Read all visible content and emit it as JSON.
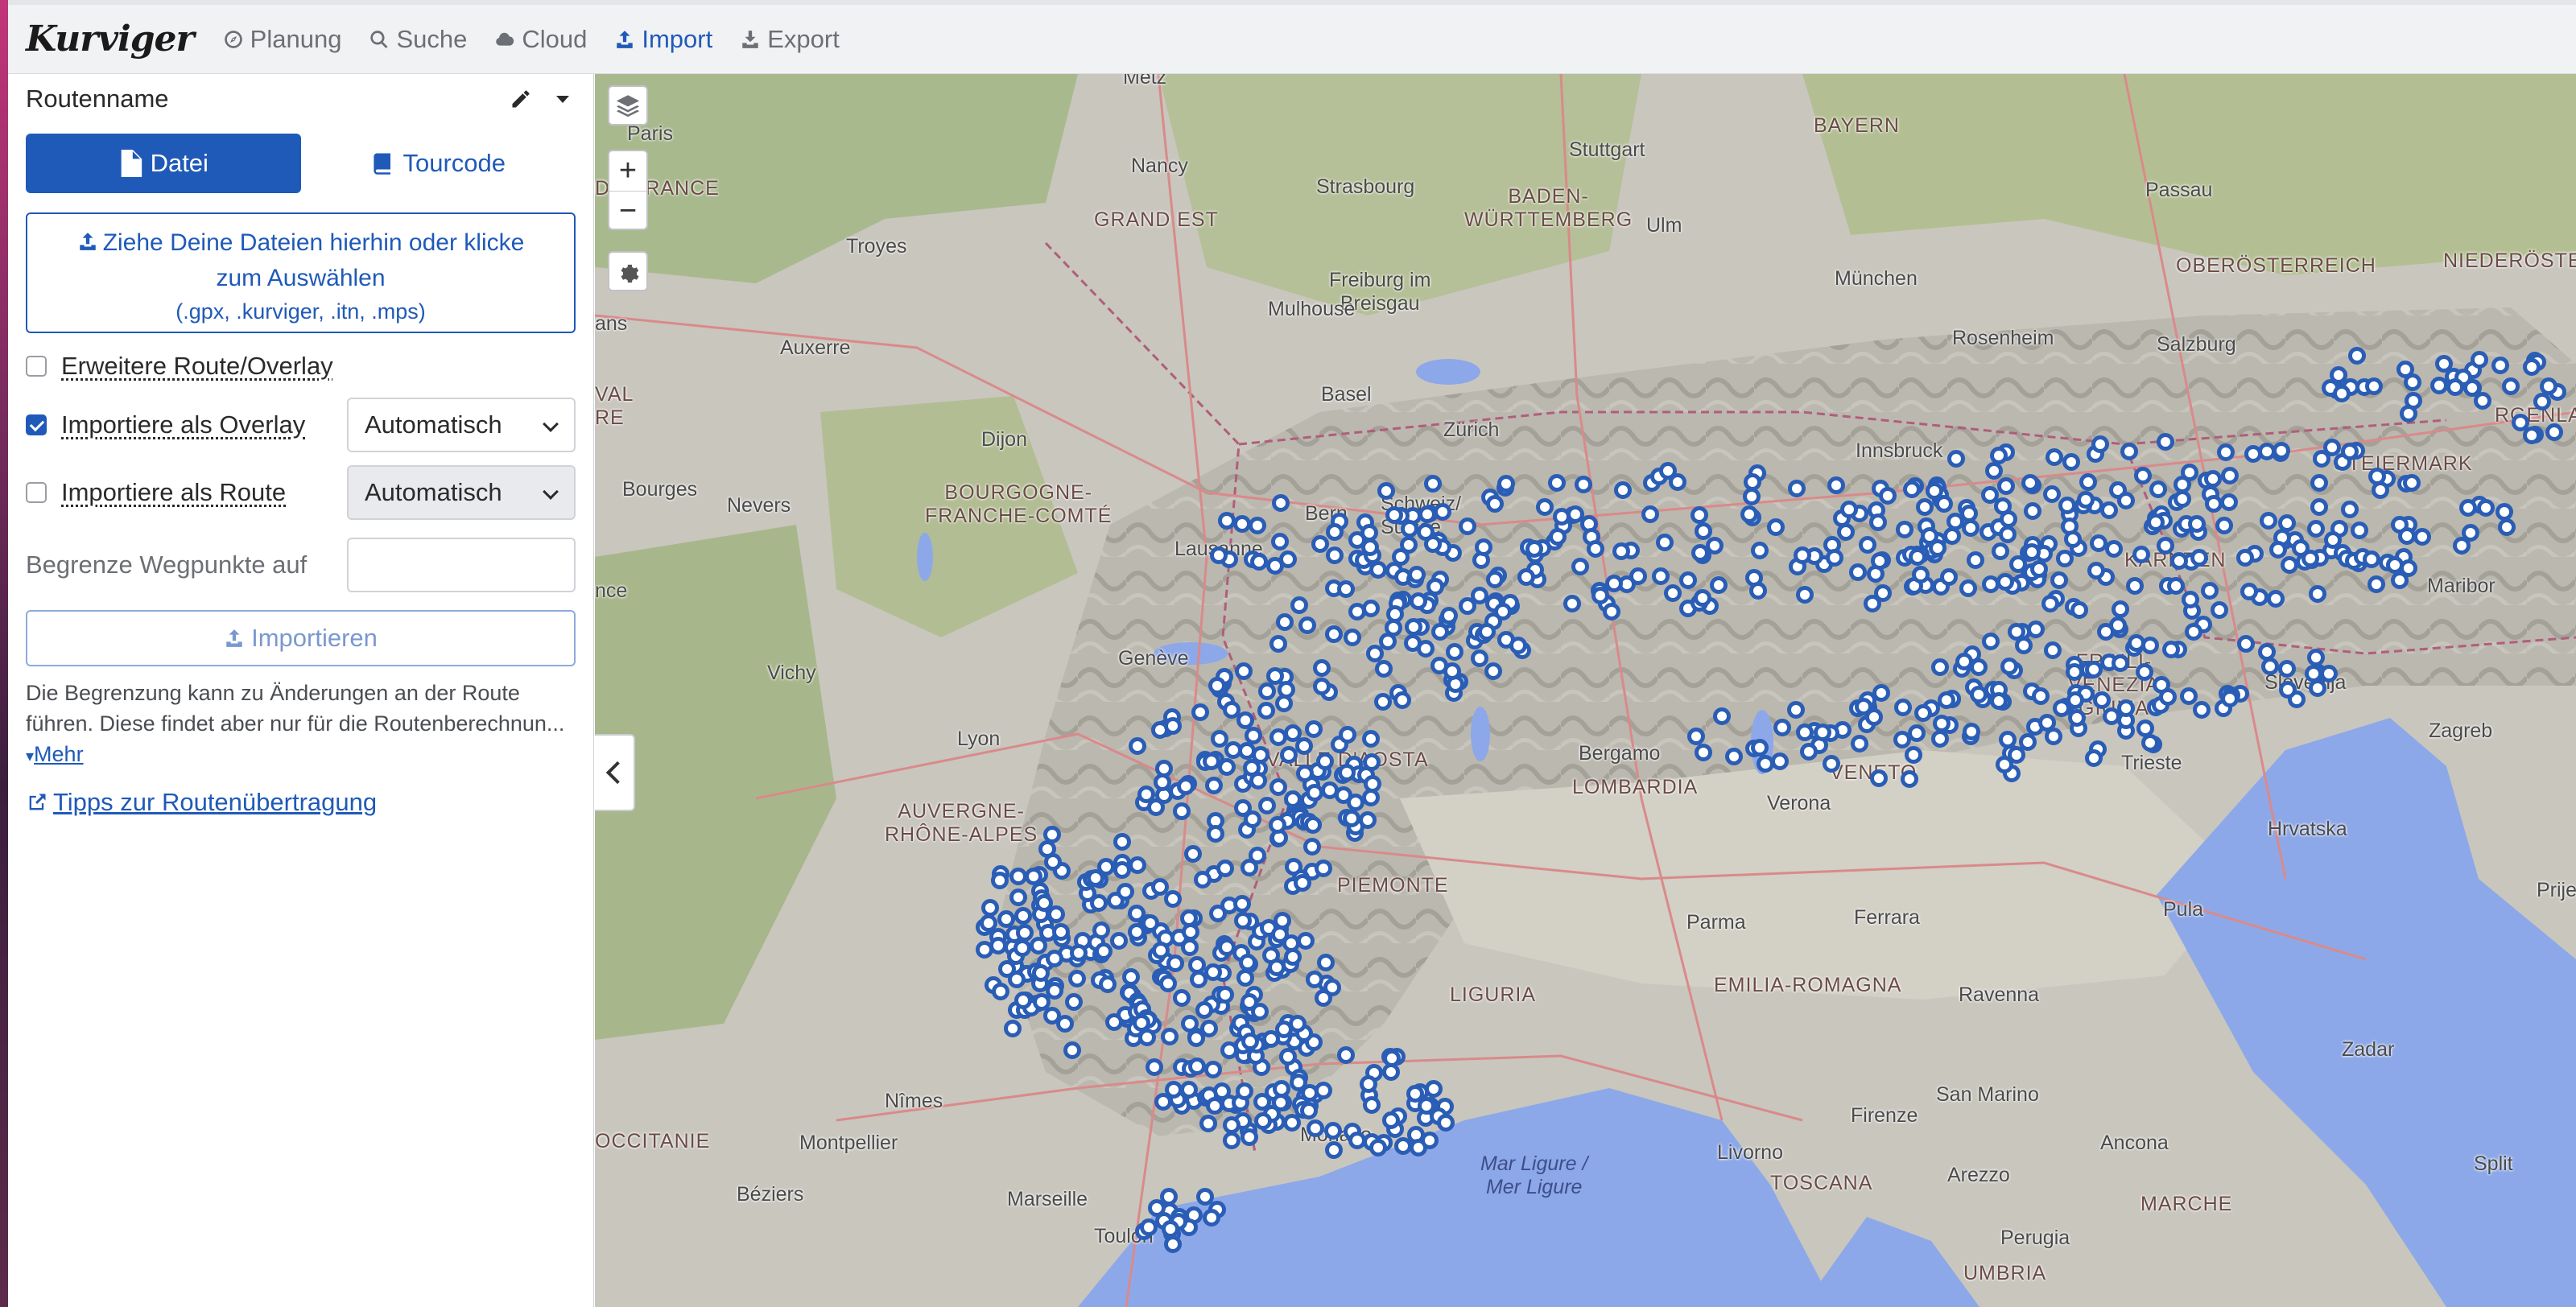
{
  "app": {
    "brand": "Kurviger"
  },
  "nav": {
    "items": [
      {
        "label": "Planung",
        "icon": "compass-icon"
      },
      {
        "label": "Suche",
        "icon": "search-icon"
      },
      {
        "label": "Cloud",
        "icon": "cloud-icon"
      },
      {
        "label": "Import",
        "icon": "upload-icon",
        "active": true
      },
      {
        "label": "Export",
        "icon": "download-icon"
      }
    ]
  },
  "sidebar": {
    "route_name": "Routenname",
    "tabs": {
      "file": "Datei",
      "tourcode": "Tourcode"
    },
    "dropzone": {
      "main": "Ziehe Deine Dateien hierhin oder klicke zum Auswählen",
      "formats": "(.gpx, .kurviger, .itn, .mps)"
    },
    "options": {
      "extended": {
        "label": "Erweitere Route/Overlay",
        "checked": false
      },
      "overlay": {
        "label": "Importiere als Overlay",
        "checked": true,
        "select": "Automatisch"
      },
      "route": {
        "label": "Importiere als Route",
        "checked": false,
        "select": "Automatisch"
      }
    },
    "limit": {
      "label": "Begrenze Wegpunkte auf",
      "value": ""
    },
    "import_button": "Importieren",
    "hint": "Die Begrenzung kann zu Änderungen an der Route führen. Diese findet aber nur für die Routenberechnun...",
    "more": "Mehr",
    "tips_link": "Tipps zur Routenübertragung"
  },
  "map": {
    "controls": {
      "zoom_in": "+",
      "zoom_out": "−"
    },
    "labels": {
      "metz": "Metz",
      "paris": "Paris",
      "de_france": "DE-FRANCE",
      "nancy": "Nancy",
      "grand_est": "GRAND EST",
      "strasbourg": "Strasbourg",
      "stuttgart": "Stuttgart",
      "baden": "BADEN-\nWÜRTTEMBERG",
      "ulm": "Ulm",
      "bayern": "BAYERN",
      "passau": "Passau",
      "troyes": "Troyes",
      "freiburg": "Freiburg im\nBreisgau",
      "munchen": "München",
      "oberosterreich": "OBERÖSTERREICH",
      "niederosterreich": "NIEDERÖSTERREICH",
      "auxerre": "Auxerre",
      "mulhouse": "Mulhouse",
      "rosenheim": "Rosenheim",
      "salzburg": "Salzburg",
      "ans": "ans",
      "basel": "Basel",
      "zurich": "Zürich",
      "val_re": "VAL\nRE",
      "dijon": "Dijon",
      "innsbruck": "Innsbruck",
      "bourgogne": "BOURGOGNE-\nFRANCHE-COMTÉ",
      "bourges": "Bourges",
      "nevers": "Nevers",
      "bern": "Bern",
      "schweiz": "Schweiz/\nSuisse",
      "steiermark": "STEIERMARK",
      "rgenland": "RGENLAND",
      "lausanne": "Lausanne",
      "nce": "nce",
      "maribor": "Maribor",
      "kaernten": "KÄRNTEN",
      "geneve": "Genève",
      "vichy": "Vichy",
      "friuli": "FRIULI-\nVENEZIA\nGIULIA",
      "slovenija": "Slovenija",
      "valle": "VALLE D'AOSTA",
      "zagreb": "Zagreb",
      "lyon": "Lyon",
      "bergamo": "Bergamo",
      "lombardia": "LOMBARDIA",
      "veneto": "VENETO",
      "trieste": "Trieste",
      "verona": "Verona",
      "auvergne": "AUVERGNE-\nRHÔNE-ALPES",
      "hrvatska": "Hrvatska",
      "piemonte": "PIEMONTE",
      "pula": "Pula",
      "prijed": "Prijed",
      "parma": "Parma",
      "ferrara": "Ferrara",
      "emilia": "EMILIA-ROMAGNA",
      "ravenna": "Ravenna",
      "liguria": "LIGURIA",
      "zadar": "Zadar",
      "nimes": "Nîmes",
      "san_marino": "San Marino",
      "occitanie": "OCCITANIE",
      "montpellier": "Montpellier",
      "monaco": "Monaco",
      "firenze": "Firenze",
      "ancona": "Ancona",
      "mar_ligure": "Mar Ligure /\nMer Ligure",
      "split": "Split",
      "livorno": "Livorno",
      "beziers": "Béziers",
      "toscana": "TOSCANA",
      "arezzo": "Arezzo",
      "marche": "MARCHE",
      "marseille": "Marseille",
      "toulon": "Toulon",
      "perugia": "Perugia",
      "umbria": "UMBRIA"
    }
  }
}
